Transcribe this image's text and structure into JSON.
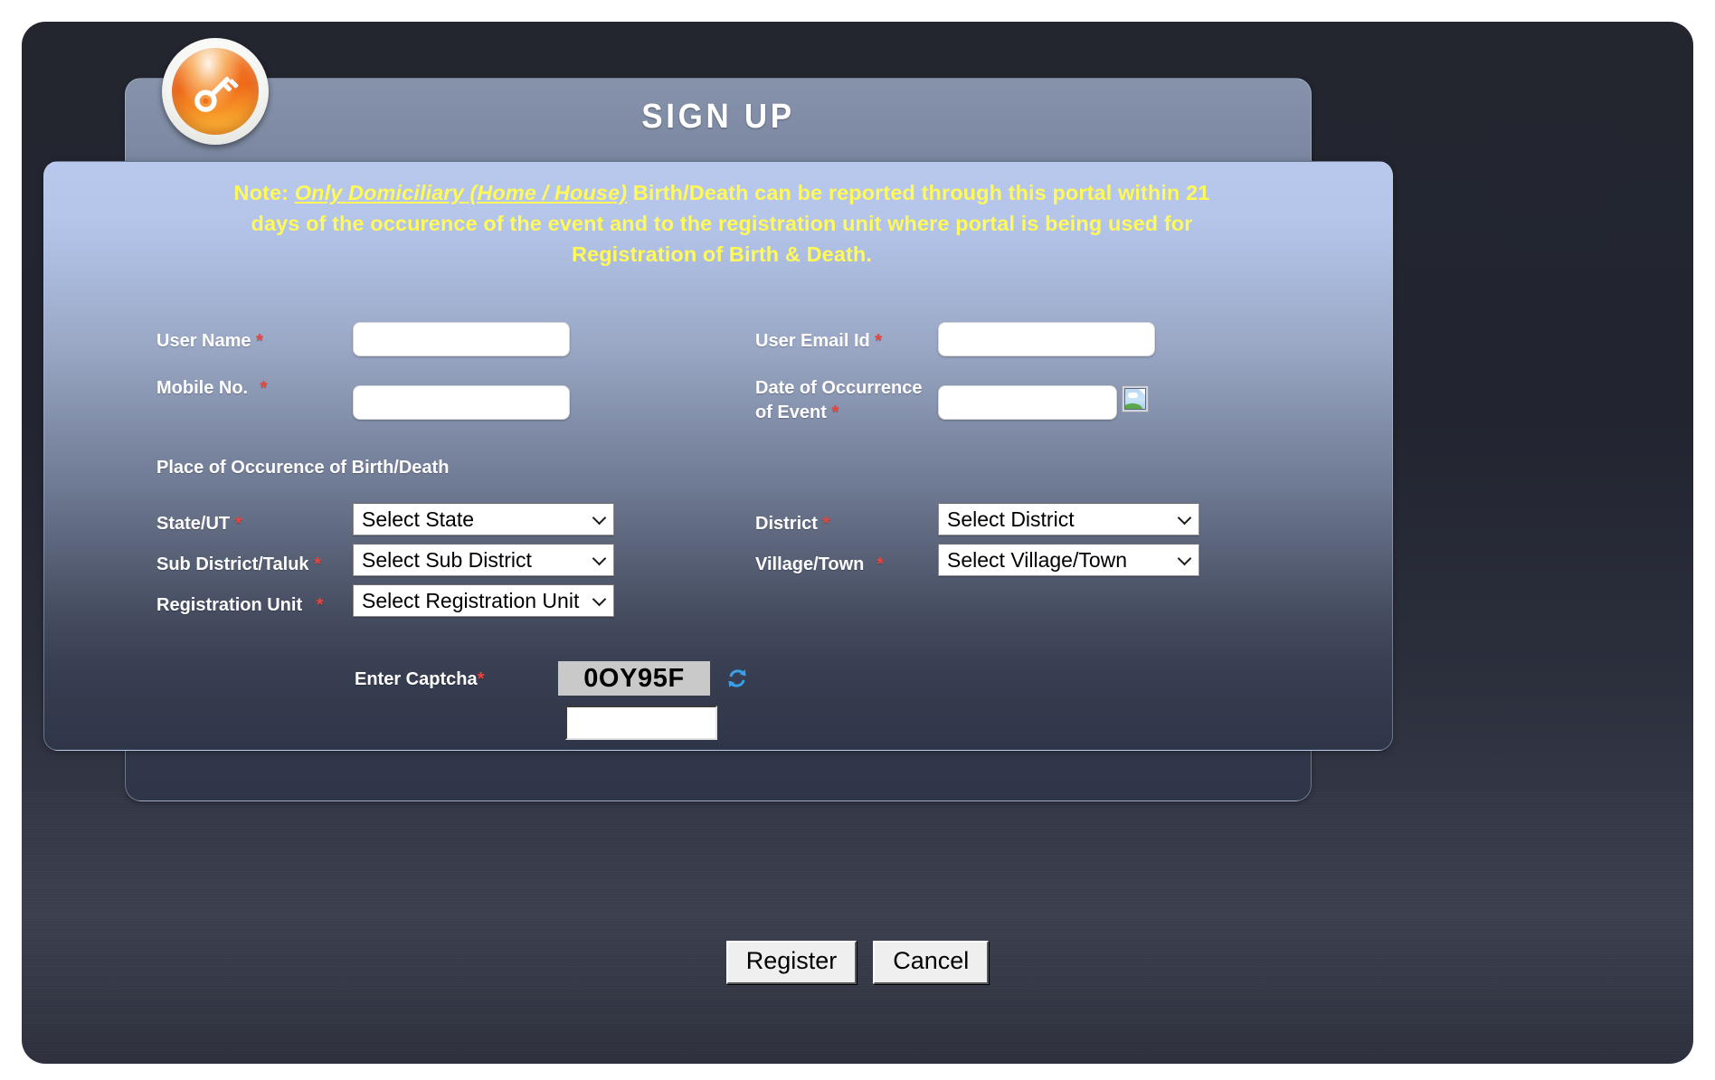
{
  "header": {
    "title": "SIGN UP",
    "logo_icon": "key-icon"
  },
  "note": {
    "prefix": "Note: ",
    "highlight": "Only Domiciliary (Home / House)",
    "rest": " Birth/Death can be reported through this portal within 21 days of the occurence of the event and to the registration unit where portal is being used for Registration of Birth & Death."
  },
  "form": {
    "user_name_label": "User Name",
    "user_name_value": "",
    "user_email_label": "User Email Id",
    "user_email_value": "",
    "mobile_label": "Mobile No.",
    "mobile_value": "",
    "date_label_line1": "Date of Occurrence",
    "date_label_line2": "of Event",
    "date_value": "",
    "date_picker_icon": "broken-image-icon",
    "section_heading": "Place of Occurence of Birth/Death",
    "state_label": "State/UT",
    "state_value": "Select State",
    "district_label": "District",
    "district_value": "Select District",
    "subdistrict_label": "Sub District/Taluk",
    "subdistrict_value": "Select Sub District",
    "village_label": "Village/Town",
    "village_value": "Select Village/Town",
    "regunit_label": "Registration Unit",
    "regunit_value": "Select Registration Unit",
    "required_marker": "*"
  },
  "captcha": {
    "label": "Enter Captcha",
    "required_marker": "*",
    "code": "0OY95F",
    "input_value": "",
    "refresh_icon": "refresh-icon"
  },
  "actions": {
    "register_label": "Register",
    "cancel_label": "Cancel"
  },
  "colors": {
    "note_yellow": "#fff95a",
    "required_red": "#e8453c",
    "label_white": "#ffffff",
    "panel_blue": "#b7c8ec",
    "shell_dark": "#23262f",
    "captcha_gray": "#c9c9c9"
  }
}
